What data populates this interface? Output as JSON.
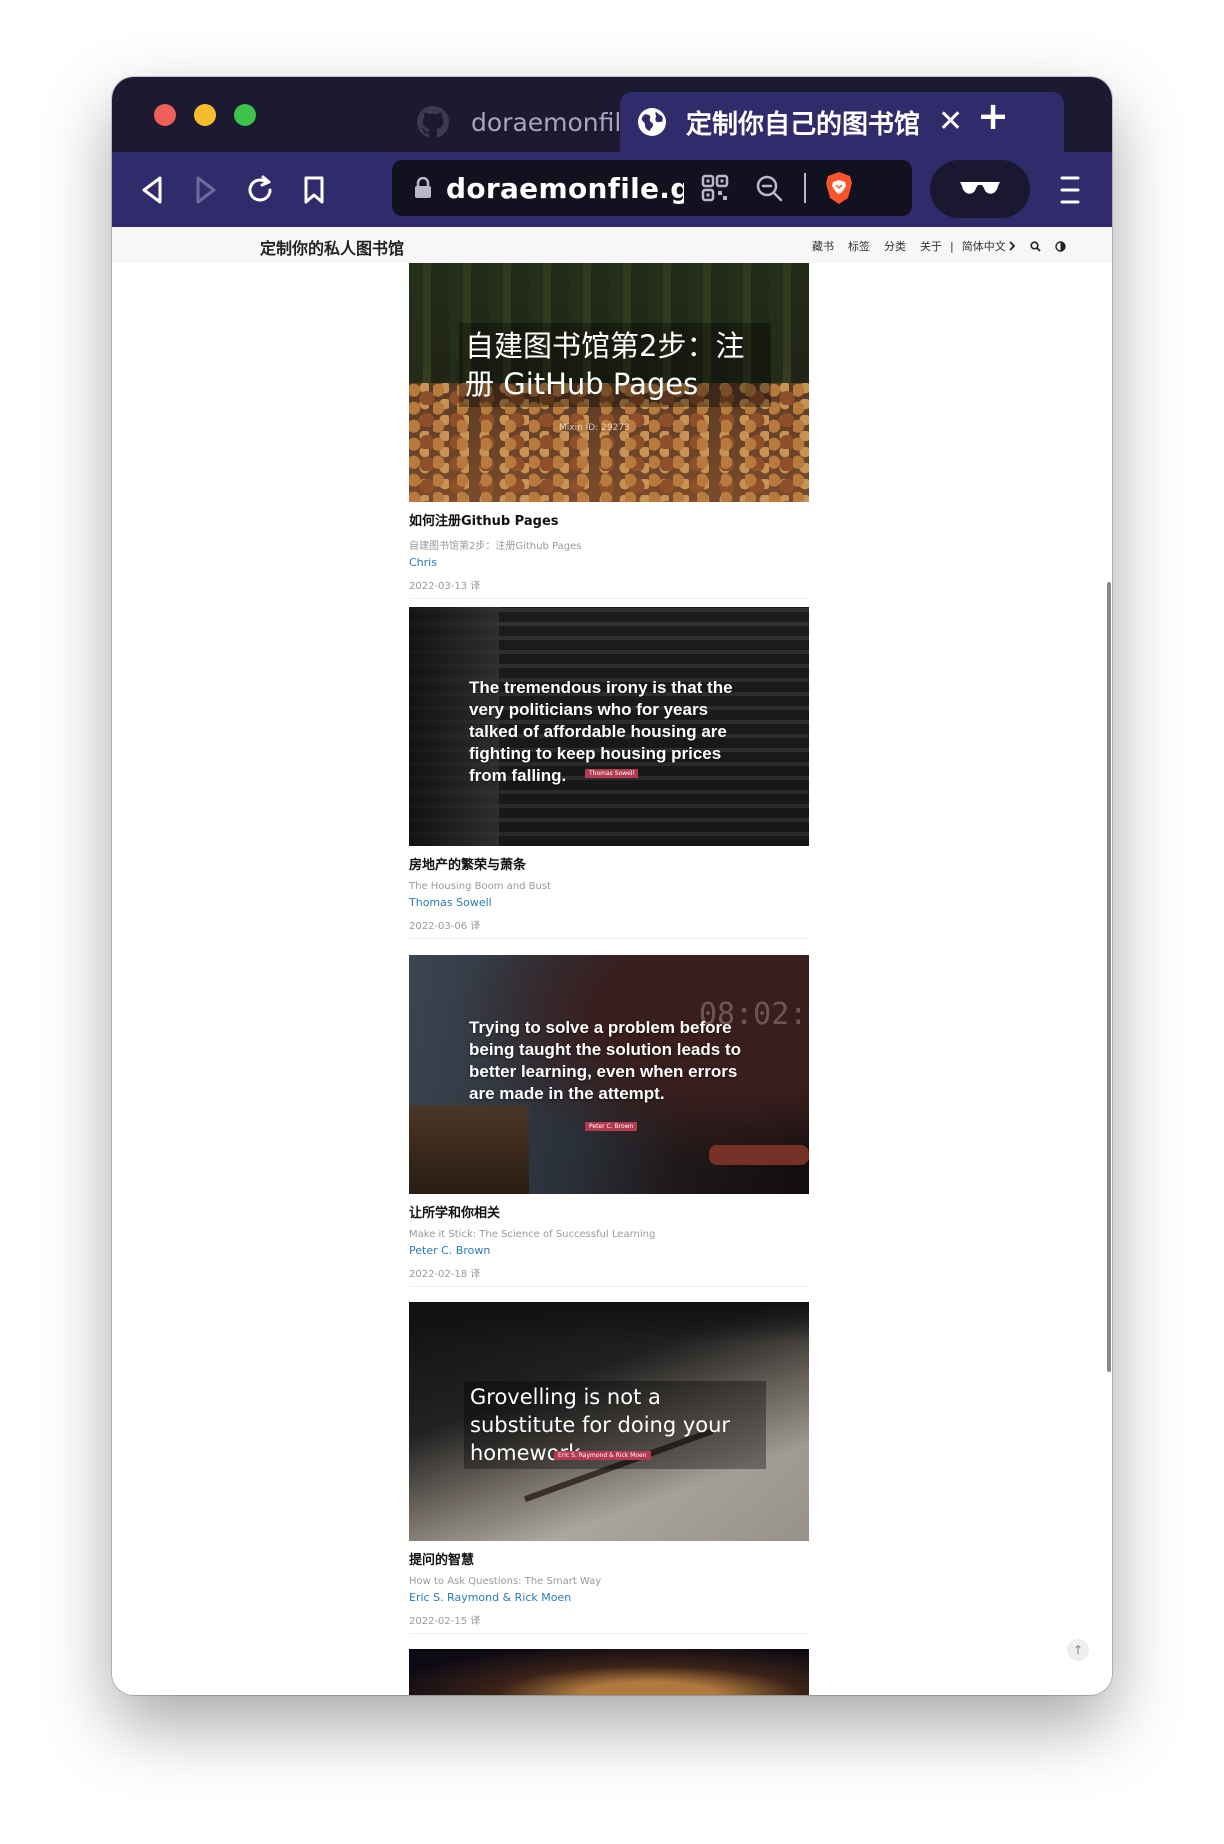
{
  "browser": {
    "tabs": [
      {
        "title": "doraemonfile/doraemonfile.github.io",
        "icon": "github-icon",
        "active": false
      },
      {
        "title": "定制你自己的图书馆",
        "icon": "globe-icon",
        "active": true
      }
    ],
    "url": "doraemonfile.github.io",
    "colors": {
      "tabstrip": "#1c1a30",
      "toolbar": "#312a6b",
      "urlbar": "#12111f"
    }
  },
  "site": {
    "title": "定制你的私人图书馆",
    "nav": {
      "books": "藏书",
      "tags": "标签",
      "categories": "分类",
      "about": "关于",
      "separator": "|",
      "language": "简体中文"
    }
  },
  "posts": [
    {
      "cover_text": "自建图书馆第2步：注册 GitHub Pages",
      "cover_credit": "Mixin ID: 29273",
      "title": "如何注册Github Pages",
      "subtitle": "自建图书馆第2步：注册Github Pages",
      "author": "Chris",
      "date": "2022-03-13 译"
    },
    {
      "cover_text": "The tremendous irony is that the very politicians who for years talked of affordable housing are fighting to keep housing prices from falling.",
      "cover_credit": "Thomas Sowell",
      "title": "房地产的繁荣与萧条",
      "subtitle": "The Housing Boom and Bust",
      "author": "Thomas Sowell",
      "date": "2022-03-06 译"
    },
    {
      "cover_text": "Trying to solve a problem before being taught the solution leads to better learning, even when errors are made in the attempt.",
      "cover_credit": "Peter C. Brown",
      "title": "让所学和你相关",
      "subtitle": "Make it Stick: The Science of Successful Learning",
      "author": "Peter C. Brown",
      "date": "2022-02-18 译"
    },
    {
      "cover_text": "Grovelling is not a substitute for doing your homework.",
      "cover_credit": "Eric S. Raymond & Rick Moen",
      "title": "提问的智慧",
      "subtitle": "How to Ask Questions: The Smart Way",
      "author": "Eric S. Raymond & Rick Moen",
      "date": "2022-02-15 译"
    }
  ],
  "back_to_top": "↑"
}
